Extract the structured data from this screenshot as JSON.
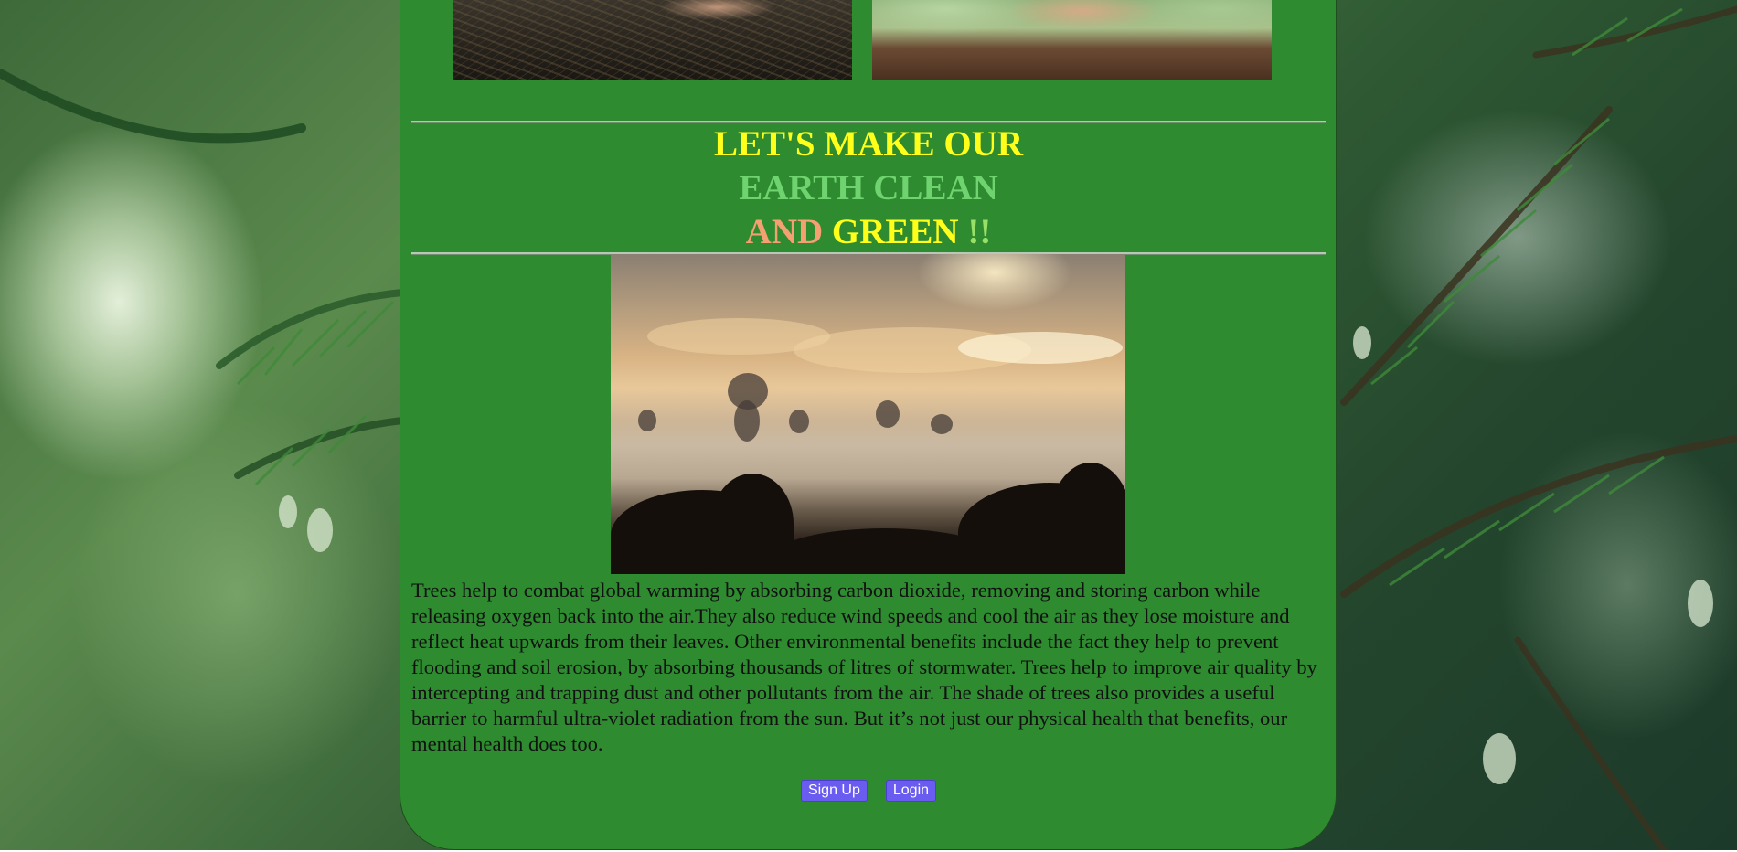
{
  "heading": {
    "line1": "LET'S MAKE OUR",
    "line2": "EARTH CLEAN",
    "line3_word1": "AND",
    "line3_word2": "GREEN",
    "line3_word3": "!!"
  },
  "article": {
    "paragraph": "Trees help to combat global warming by absorbing carbon dioxide, removing and storing carbon while releasing oxygen back into the air.They also reduce wind speeds and cool the air as they lose moisture and reflect heat upwards from their leaves. Other environmental benefits include the fact they help to prevent flooding and soil erosion, by absorbing thousands of litres of stormwater. Trees help to improve air quality by intercepting and trapping dust and other pollutants from the air. The shade of trees also provides a useful barrier to harmful ultra-violet radiation from the sun. But it’s not just our physical health that benefits, our mental health does too."
  },
  "actions": {
    "signup_label": "Sign Up",
    "login_label": "Login"
  },
  "colors": {
    "panel": "#2e8b30",
    "heading_yellow": "#ffff1a",
    "heading_light_green": "#6fd36f",
    "heading_salmon": "#f4a070",
    "button": "#6a5cf0"
  }
}
